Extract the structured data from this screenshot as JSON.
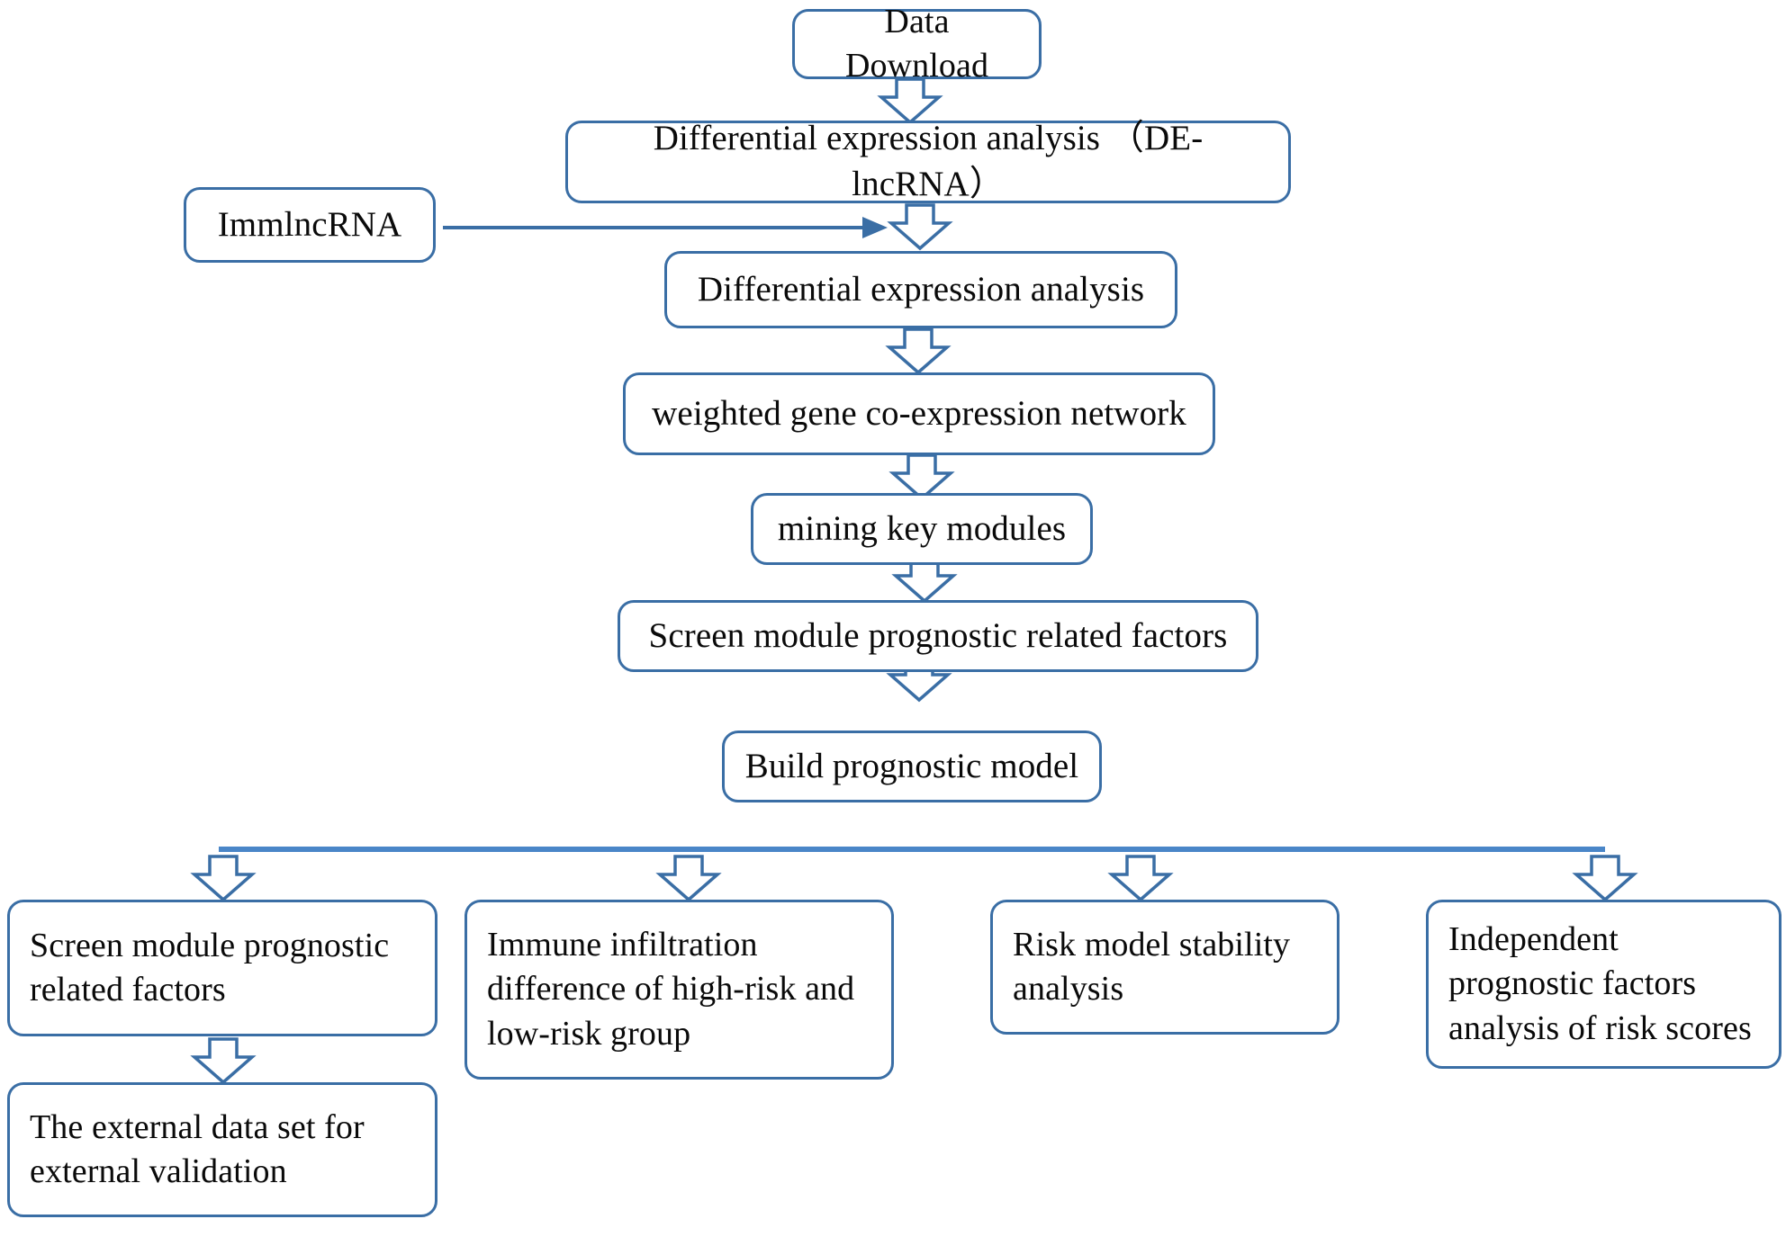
{
  "diagram": {
    "title": "Study workflow flowchart",
    "colors": {
      "box_border": "#3a6ea5",
      "connector_line": "#4a86c8",
      "arrow_fill": "#ffffff",
      "text": "#000000",
      "background": "#ffffff"
    },
    "nodes": [
      {
        "id": "data-download",
        "label": "Data Download"
      },
      {
        "id": "de-lncrna",
        "label": "Differential expression analysis （DE-lncRNA）"
      },
      {
        "id": "immlncrna",
        "label": "ImmlncRNA"
      },
      {
        "id": "de-analysis",
        "label": "Differential expression analysis"
      },
      {
        "id": "wgcna",
        "label": "weighted gene co-expression network"
      },
      {
        "id": "mining-key-modules",
        "label": "mining key modules"
      },
      {
        "id": "screen-module-top",
        "label": "Screen module prognostic related factors"
      },
      {
        "id": "build-model",
        "label": "Build prognostic model"
      },
      {
        "id": "screen-module-bottom",
        "label": "Screen module prognostic related factors"
      },
      {
        "id": "immune-infiltration",
        "label": "Immune infiltration difference of high-risk and low-risk group"
      },
      {
        "id": "risk-stability",
        "label": "Risk model stability analysis"
      },
      {
        "id": "independent-prognostic",
        "label": "Independent prognostic factors analysis of risk scores"
      },
      {
        "id": "external-validation",
        "label": "The external data set for external validation"
      }
    ],
    "connectors": [
      {
        "from": "data-download",
        "to": "de-lncrna",
        "type": "block-arrow-down"
      },
      {
        "from": "immlncrna",
        "to": "de-analysis",
        "type": "line-arrow-right"
      },
      {
        "from": "de-lncrna",
        "to": "de-analysis",
        "type": "block-arrow-down"
      },
      {
        "from": "de-analysis",
        "to": "wgcna",
        "type": "block-arrow-down"
      },
      {
        "from": "wgcna",
        "to": "mining-key-modules",
        "type": "block-arrow-down"
      },
      {
        "from": "mining-key-modules",
        "to": "screen-module-top",
        "type": "block-arrow-down"
      },
      {
        "from": "screen-module-top",
        "to": "build-model",
        "type": "block-arrow-down"
      },
      {
        "from": "build-model",
        "to": "branch-bus",
        "type": "block-arrow-down"
      },
      {
        "from": "branch-bus",
        "to": "screen-module-bottom",
        "type": "block-arrow-down"
      },
      {
        "from": "branch-bus",
        "to": "immune-infiltration",
        "type": "block-arrow-down"
      },
      {
        "from": "branch-bus",
        "to": "risk-stability",
        "type": "block-arrow-down"
      },
      {
        "from": "branch-bus",
        "to": "independent-prognostic",
        "type": "block-arrow-down"
      },
      {
        "from": "screen-module-bottom",
        "to": "external-validation",
        "type": "block-arrow-down"
      }
    ]
  }
}
